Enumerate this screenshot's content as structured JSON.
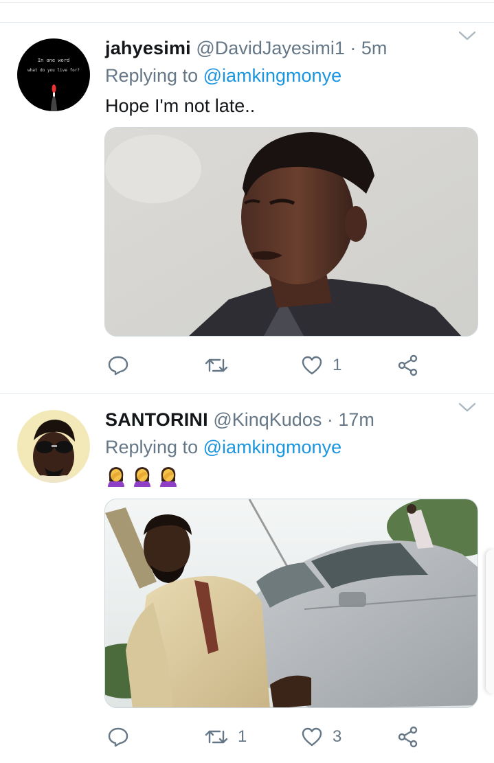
{
  "tweets": [
    {
      "name": "jahyesimi",
      "handle": "@DavidJayesimi1",
      "separator": "·",
      "time": "5m",
      "replying_prefix": "Replying to",
      "replying_to": "@iamkingmonye",
      "text": "Hope I'm not late..",
      "avatar_text_line1": "In one word",
      "avatar_text_line2": "what do you live for?",
      "replies": "",
      "retweets": "",
      "likes": "1",
      "icons": [
        "reply-icon",
        "retweet-icon",
        "like-icon",
        "share-icon",
        "chevron-down-icon"
      ]
    },
    {
      "name": "SANTORINI",
      "handle": "@KinqKudos",
      "separator": "·",
      "time": "17m",
      "replying_prefix": "Replying to",
      "replying_to": "@iamkingmonye",
      "emoji": [
        "facepalm-emoji",
        "facepalm-emoji",
        "facepalm-emoji"
      ],
      "replies": "",
      "retweets": "1",
      "likes": "3",
      "icons": [
        "reply-icon",
        "retweet-icon",
        "like-icon",
        "share-icon",
        "chevron-down-icon"
      ]
    }
  ],
  "colors": {
    "link": "#1b95e0",
    "secondary_text": "#657786",
    "primary_text": "#14171a",
    "divider": "#e1e8ed"
  }
}
